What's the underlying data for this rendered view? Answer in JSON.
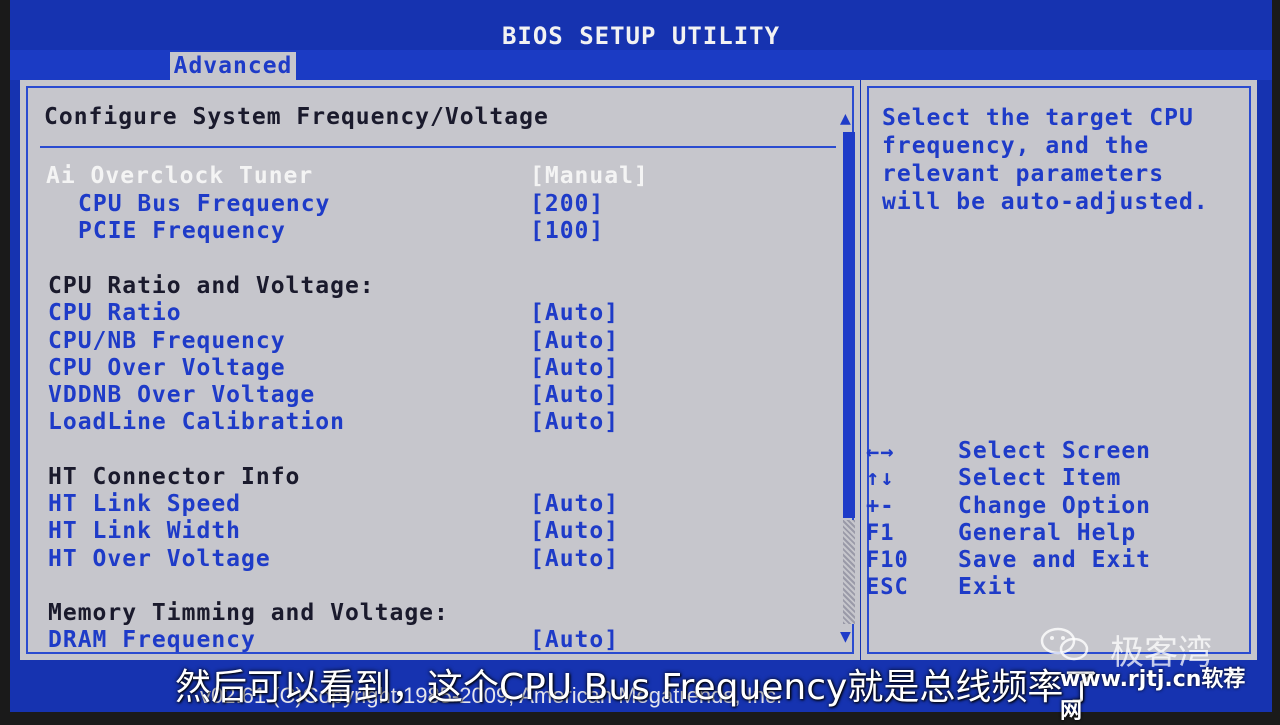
{
  "window": {
    "title": "BIOS SETUP UTILITY"
  },
  "menu": {
    "tabs": [
      {
        "label": "Advanced",
        "selected": true
      }
    ]
  },
  "main": {
    "heading": "Configure System Frequency/Voltage",
    "rows": [
      {
        "label": "Ai Overclock Tuner",
        "value": "[Manual]"
      },
      {
        "label": "CPU Bus Frequency",
        "value": "[200]"
      },
      {
        "label": "PCIE Frequency",
        "value": "[100]"
      },
      {
        "label": "CPU Ratio and Voltage:"
      },
      {
        "label": "CPU Ratio",
        "value": "[Auto]"
      },
      {
        "label": "CPU/NB Frequency",
        "value": "[Auto]"
      },
      {
        "label": "CPU Over Voltage",
        "value": "[Auto]"
      },
      {
        "label": "VDDNB Over Voltage",
        "value": "[Auto]"
      },
      {
        "label": "LoadLine Calibration",
        "value": "[Auto]"
      },
      {
        "label": "HT Connector Info"
      },
      {
        "label": "HT Link Speed",
        "value": "[Auto]"
      },
      {
        "label": "HT Link Width",
        "value": "[Auto]"
      },
      {
        "label": "HT Over Voltage",
        "value": "[Auto]"
      },
      {
        "label": "Memory Timming and Voltage:"
      },
      {
        "label": "DRAM Frequency",
        "value": "[Auto]"
      }
    ]
  },
  "help": {
    "text": "Select the target CPU\nfrequency, and the\nrelevant parameters\nwill be auto-adjusted.",
    "keys": [
      {
        "key": "←→",
        "desc": "Select Screen"
      },
      {
        "key": "↑↓",
        "desc": "Select Item"
      },
      {
        "key": "+-",
        "desc": "Change Option"
      },
      {
        "key": "F1",
        "desc": "General Help"
      },
      {
        "key": "F10",
        "desc": "Save and Exit"
      },
      {
        "key": "ESC",
        "desc": "Exit"
      }
    ]
  },
  "footer": {
    "text": "v02.61 (C)Copyright 1985-2009, American Megatrends, Inc."
  },
  "overlay": {
    "subtitle": "然后可以看到，这个CPU Bus Frequency就是总线频率了",
    "watermark_name": "极客湾",
    "watermark_url": "www.rjtj.cn软荐网"
  },
  "colors": {
    "bios_blue": "#1633b0",
    "panel_gray": "#c6c6cc",
    "text_blue": "#1e3bc8"
  }
}
